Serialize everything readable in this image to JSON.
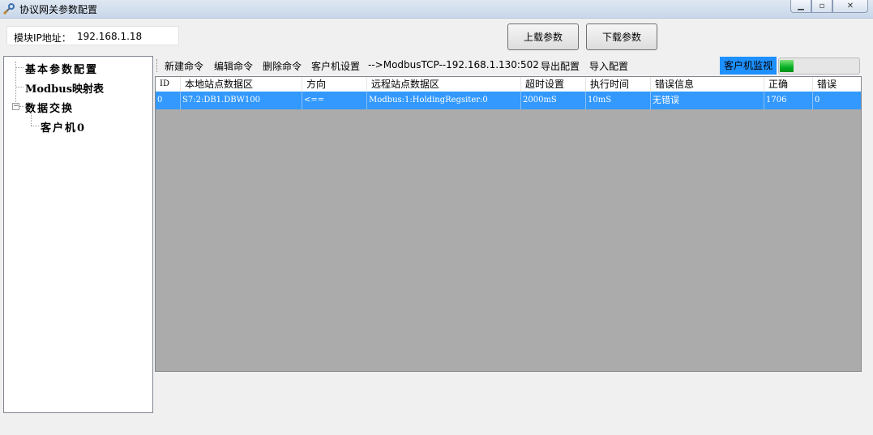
{
  "window": {
    "title": "协议网关参数配置",
    "minimize_icon": "minimize-icon",
    "maximize_icon": "maximize-icon",
    "close_icon": "close-icon"
  },
  "top": {
    "ip_label": "模块IP地址：",
    "ip_value": "192.168.1.18",
    "upload_label": "上载参数",
    "download_label": "下载参数"
  },
  "tree": {
    "items": [
      {
        "label": "基本参数配置"
      },
      {
        "label": "Modbus映射表"
      },
      {
        "label": "数据交换"
      },
      {
        "label": "客户机0"
      }
    ]
  },
  "toolbar": {
    "new_cmd": "新建命令",
    "edit_cmd": "编辑命令",
    "delete_cmd": "删除命令",
    "client_settings": "客户机设置",
    "connection": "-->ModbusTCP--192.168.1.130:502",
    "export_config": "导出配置",
    "import_config": "导入配置",
    "monitor_label": "客户机监视",
    "monitor_progress": 0.18,
    "accent_color": "#1e90ff",
    "progress_color": "#06b025"
  },
  "grid": {
    "columns": [
      "ID",
      "本地站点数据区",
      "方向",
      "远程站点数据区",
      "超时设置",
      "执行时间",
      "错误信息",
      "正确",
      "错误"
    ],
    "rows": [
      [
        "0",
        "S7:2:DB1.DBW100",
        "<==",
        "Modbus:1:HoldingRegsiter:0",
        "2000mS",
        "10mS",
        "无错误",
        "1706",
        "0"
      ]
    ],
    "selected_row_color": "#3399ff"
  }
}
